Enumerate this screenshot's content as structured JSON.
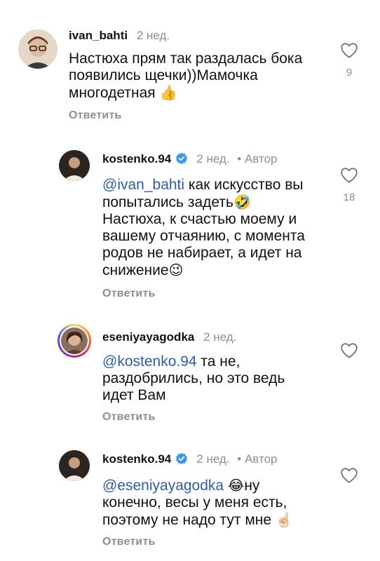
{
  "comments": [
    {
      "username": "ivan_bahti",
      "time": "2 нед.",
      "text_lines": [
        "Настюха прям так раздалась бока",
        "появились щечки))Мамочка",
        "многодетная"
      ],
      "emoji_end": "👍",
      "reply_label": "Ответить",
      "likes": "9"
    },
    {
      "username": "kostenko.94",
      "time": "2 нед.",
      "author_label": "• Автор",
      "mention": "@ivan_bahti",
      "text_lines": [
        "как искусство вы",
        "попытались задеть",
        "Настюха, к счастью моему и",
        "вашему отчаянию, с момента",
        "родов не набирает, а идет на",
        "снижение"
      ],
      "emoji_1": "🤣",
      "emoji_2": "😉",
      "reply_label": "Ответить",
      "likes": "18"
    },
    {
      "username": "eseniyayagodka",
      "time": "2 нед.",
      "mention": "@kostenko.94",
      "text_lines": [
        "та не,",
        "раздобрились, но это ведь",
        "идет Вам"
      ],
      "reply_label": "Ответить"
    },
    {
      "username": "kostenko.94",
      "time": "2 нед.",
      "author_label": "• Автор",
      "mention": "@eseniyayagodka",
      "emoji_1": "😂",
      "text_lines": [
        "ну",
        "конечно, весы у меня есть,",
        "поэтому не надо тут мне"
      ],
      "emoji_end": "☝🏻",
      "reply_label": "Ответить"
    }
  ],
  "icons": {
    "like": "heart-outline-icon",
    "verified": "verified-badge-icon"
  },
  "colors": {
    "mention": "#2b5fa9",
    "verified": "#3897f0",
    "muted": "#8e8e8e"
  }
}
